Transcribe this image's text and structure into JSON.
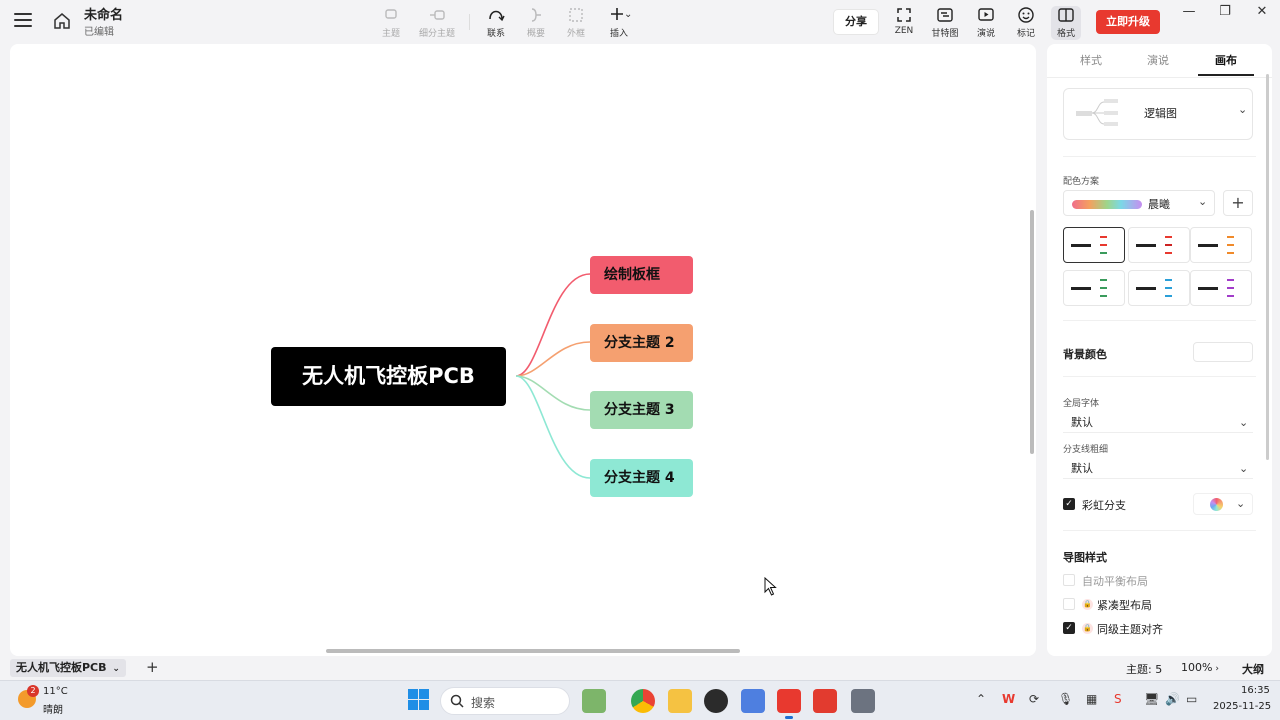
{
  "app": {
    "doc_title": "未命名",
    "doc_status": "已编辑"
  },
  "toolbar": {
    "topic": "主题",
    "subtopic": "细分主题",
    "relation": "联系",
    "summary": "概要",
    "boundary": "外框",
    "insert": "插入",
    "share": "分享",
    "zen": "ZEN",
    "gantt": "甘特图",
    "present": "演说",
    "marker": "标记",
    "format": "格式",
    "upgrade": "立即升级"
  },
  "mindmap": {
    "root": "无人机飞控板PCB",
    "branches": [
      {
        "label": "绘制板框",
        "color": "#f25c6e"
      },
      {
        "label": "分支主题 2",
        "color": "#f5a070"
      },
      {
        "label": "分支主题 3",
        "color": "#a3dcb2"
      },
      {
        "label": "分支主题 4",
        "color": "#8ee8d4"
      }
    ]
  },
  "panel": {
    "tabs": [
      "样式",
      "演说",
      "画布"
    ],
    "active_tab": "画布",
    "structure": "逻辑图",
    "color_scheme_label": "配色方案",
    "color_scheme": "晨曦",
    "bg_color_label": "背景颜色",
    "global_font_label": "全局字体",
    "global_font": "默认",
    "branch_width_label": "分支线粗细",
    "branch_width": "默认",
    "rainbow_branch": "彩虹分支",
    "map_style_label": "导图样式",
    "auto_balance": "自动平衡布局",
    "compact_layout": "紧凑型布局",
    "align_same_level": "同级主题对齐"
  },
  "status": {
    "sheet": "无人机飞控板PCB",
    "topic_count": "主题: 5",
    "zoom": "100%",
    "outline": "大纲"
  },
  "taskbar": {
    "weather_badge": "2",
    "temp": "11°C",
    "weather": "晴朗",
    "search": "搜索",
    "time": "16:35",
    "date": "2025-11-25"
  }
}
